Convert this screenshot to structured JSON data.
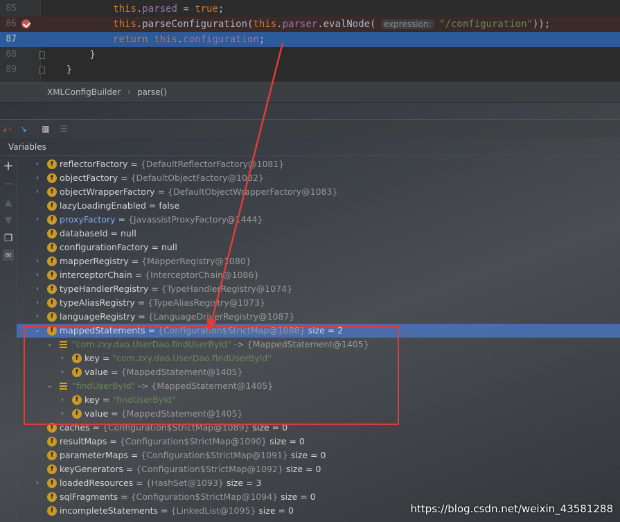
{
  "editor": {
    "lines": [
      {
        "num": "85",
        "parts": [
          {
            "t": "            ",
            "c": ""
          },
          {
            "t": "this",
            "c": "kw"
          },
          {
            "t": ".",
            "c": ""
          },
          {
            "t": "parsed",
            "c": "fld"
          },
          {
            "t": " = ",
            "c": ""
          },
          {
            "t": "true",
            "c": "kw"
          },
          {
            "t": ";",
            "c": ""
          }
        ]
      },
      {
        "num": "86",
        "parts": [
          {
            "t": "            ",
            "c": ""
          },
          {
            "t": "this",
            "c": "kw"
          },
          {
            "t": ".parseConfiguration(",
            "c": ""
          },
          {
            "t": "this",
            "c": "kw"
          },
          {
            "t": ".",
            "c": ""
          },
          {
            "t": "parser",
            "c": "fld"
          },
          {
            "t": ".evalNode( ",
            "c": ""
          },
          {
            "t": "expression:",
            "c": "hint"
          },
          {
            "t": " ",
            "c": ""
          },
          {
            "t": "\"/configuration\"",
            "c": "str"
          },
          {
            "t": "));",
            "c": ""
          }
        ]
      },
      {
        "num": "87",
        "parts": [
          {
            "t": "            ",
            "c": ""
          },
          {
            "t": "return ",
            "c": "kw"
          },
          {
            "t": "this",
            "c": "kw"
          },
          {
            "t": ".",
            "c": ""
          },
          {
            "t": "configuration",
            "c": "fld"
          },
          {
            "t": ";",
            "c": ""
          }
        ]
      },
      {
        "num": "88",
        "parts": [
          {
            "t": "        }",
            "c": ""
          }
        ]
      },
      {
        "num": "89",
        "parts": [
          {
            "t": "    }",
            "c": ""
          }
        ]
      }
    ]
  },
  "breadcrumb": {
    "class_name": "XMLConfigBuilder",
    "separator": "›",
    "method": "parse()"
  },
  "debugger": {
    "variables_title": "Variables"
  },
  "variables": [
    {
      "level": 0,
      "arrow": "›",
      "icon": "f",
      "name": "reflectorFactory",
      "eq": " = ",
      "ref": "{DefaultReflectorFactory@1081}"
    },
    {
      "level": 0,
      "arrow": "›",
      "icon": "f",
      "name": "objectFactory",
      "eq": " = ",
      "ref": "{DefaultObjectFactory@1082}"
    },
    {
      "level": 0,
      "arrow": "›",
      "icon": "f",
      "name": "objectWrapperFactory",
      "eq": " = ",
      "ref": "{DefaultObjectWrapperFactory@1083}"
    },
    {
      "level": 0,
      "arrow": "",
      "icon": "f",
      "name": "lazyLoadingEnabled",
      "eq": " = ",
      "val": "false"
    },
    {
      "level": 0,
      "arrow": "›",
      "icon": "f",
      "name": "proxyFactory",
      "name_style": "blue",
      "eq": " = ",
      "ref": "{JavassistProxyFactory@1444}"
    },
    {
      "level": 0,
      "arrow": "",
      "icon": "f",
      "name": "databaseId",
      "eq": " = ",
      "val": "null"
    },
    {
      "level": 0,
      "arrow": "",
      "icon": "f",
      "name": "configurationFactory",
      "eq": " = ",
      "val": "null"
    },
    {
      "level": 0,
      "arrow": "›",
      "icon": "f",
      "name": "mapperRegistry",
      "eq": " = ",
      "ref": "{MapperRegistry@1080}"
    },
    {
      "level": 0,
      "arrow": "›",
      "icon": "f",
      "name": "interceptorChain",
      "eq": " = ",
      "ref": "{InterceptorChain@1086}"
    },
    {
      "level": 0,
      "arrow": "›",
      "icon": "f",
      "name": "typeHandlerRegistry",
      "eq": " = ",
      "ref": "{TypeHandlerRegistry@1074}"
    },
    {
      "level": 0,
      "arrow": "›",
      "icon": "f",
      "name": "typeAliasRegistry",
      "eq": " = ",
      "ref": "{TypeAliasRegistry@1073}"
    },
    {
      "level": 0,
      "arrow": "›",
      "icon": "f",
      "name": "languageRegistry",
      "eq": " = ",
      "ref": "{LanguageDriverRegistry@1087}"
    },
    {
      "level": 0,
      "arrow": "⌄",
      "icon": "f",
      "name": "mappedStatements",
      "eq": " = ",
      "ref": "{Configuration$StrictMap@1088}",
      "extra": "  size = 2",
      "selected": true
    },
    {
      "level": 1,
      "arrow": "⌄",
      "icon": "e",
      "strname": "\"com.zxy.dao.UserDao.findUserById\"",
      "ref": " -> {MappedStatement@1405}"
    },
    {
      "level": 2,
      "arrow": "›",
      "icon": "f",
      "name": "key",
      "eq": " = ",
      "str": "\"com.zxy.dao.UserDao.findUserById\""
    },
    {
      "level": 2,
      "arrow": "›",
      "icon": "f",
      "name": "value",
      "eq": " = ",
      "ref": "{MappedStatement@1405}"
    },
    {
      "level": 1,
      "arrow": "⌄",
      "icon": "e",
      "strname": "\"findUserById\"",
      "ref": " -> {MappedStatement@1405}"
    },
    {
      "level": 2,
      "arrow": "›",
      "icon": "f",
      "name": "key",
      "eq": " = ",
      "str": "\"findUserById\""
    },
    {
      "level": 2,
      "arrow": "›",
      "icon": "f",
      "name": "value",
      "eq": " = ",
      "ref": "{MappedStatement@1405}"
    },
    {
      "level": 0,
      "arrow": "",
      "icon": "f",
      "name": "caches",
      "eq": " = ",
      "ref": "{Configuration$StrictMap@1089}",
      "extra": "  size = 0"
    },
    {
      "level": 0,
      "arrow": "",
      "icon": "f",
      "name": "resultMaps",
      "eq": " = ",
      "ref": "{Configuration$StrictMap@1090}",
      "extra": "  size = 0"
    },
    {
      "level": 0,
      "arrow": "",
      "icon": "f",
      "name": "parameterMaps",
      "eq": " = ",
      "ref": "{Configuration$StrictMap@1091}",
      "extra": "  size = 0"
    },
    {
      "level": 0,
      "arrow": "",
      "icon": "f",
      "name": "keyGenerators",
      "eq": " = ",
      "ref": "{Configuration$StrictMap@1092}",
      "extra": "  size = 0"
    },
    {
      "level": 0,
      "arrow": "›",
      "icon": "f",
      "name": "loadedResources",
      "eq": " = ",
      "ref": "{HashSet@1093}",
      "extra": "  size = 3"
    },
    {
      "level": 0,
      "arrow": "",
      "icon": "f",
      "name": "sqlFragments",
      "eq": " = ",
      "ref": "{Configuration$StrictMap@1094}",
      "extra": "  size = 0"
    },
    {
      "level": 0,
      "arrow": "",
      "icon": "f",
      "name": "incompleteStatements",
      "eq": " = ",
      "ref": "{LinkedList@1095}",
      "extra": "  size = 0"
    }
  ],
  "watermark": "https://blog.csdn.net/weixin_43581288",
  "colors": {
    "selection": "#4b6eaf",
    "annotation": "#e23b3b",
    "editor_bg": "#2b2b2b"
  }
}
